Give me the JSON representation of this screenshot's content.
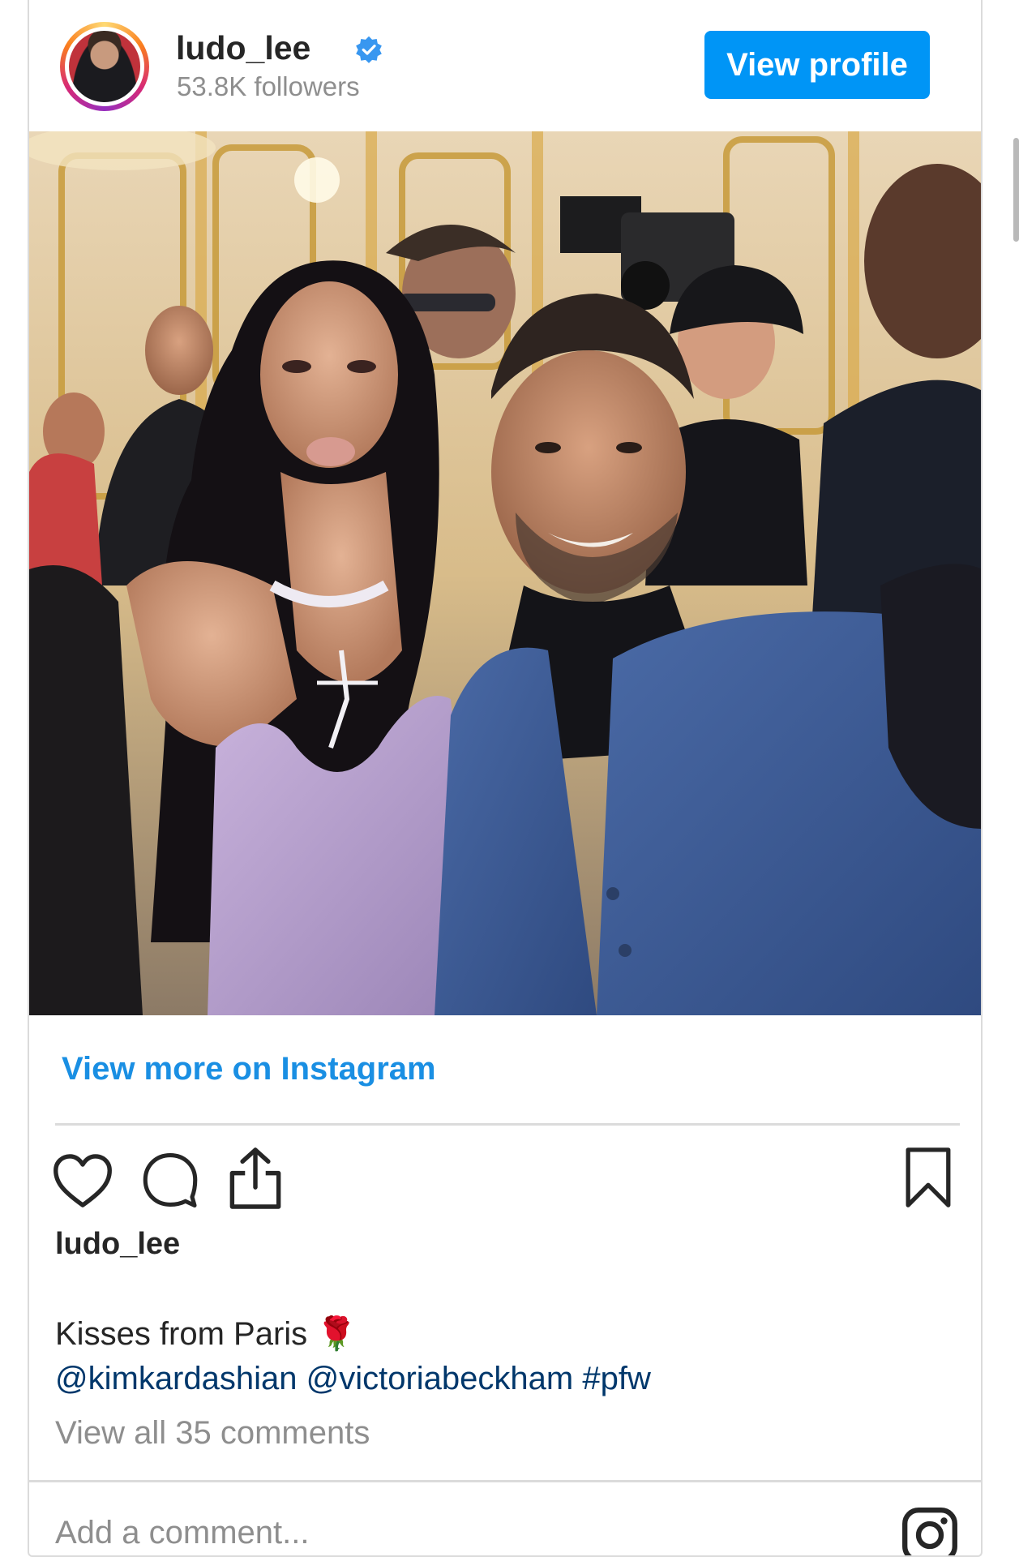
{
  "header": {
    "username": "ludo_lee",
    "verified_icon": "verified-badge-icon",
    "followers": "53.8K followers",
    "view_profile_label": "View profile"
  },
  "links": {
    "view_more": "View more on Instagram"
  },
  "actions": {
    "like_icon": "heart-icon",
    "comment_icon": "comment-bubble-icon",
    "share_icon": "share-icon",
    "save_icon": "bookmark-icon"
  },
  "caption": {
    "username": "ludo_lee",
    "text": "Kisses from Paris 🌹",
    "tags": "@kimkardashian @victoriabeckham #pfw"
  },
  "comments": {
    "view_all": "View all 35 comments",
    "add_placeholder": "Add a comment..."
  },
  "colors": {
    "accent": "#0095f6",
    "link": "#1a8fe3",
    "tag": "#00376b",
    "muted": "#8e8e8e",
    "border": "#dbdbdb"
  }
}
